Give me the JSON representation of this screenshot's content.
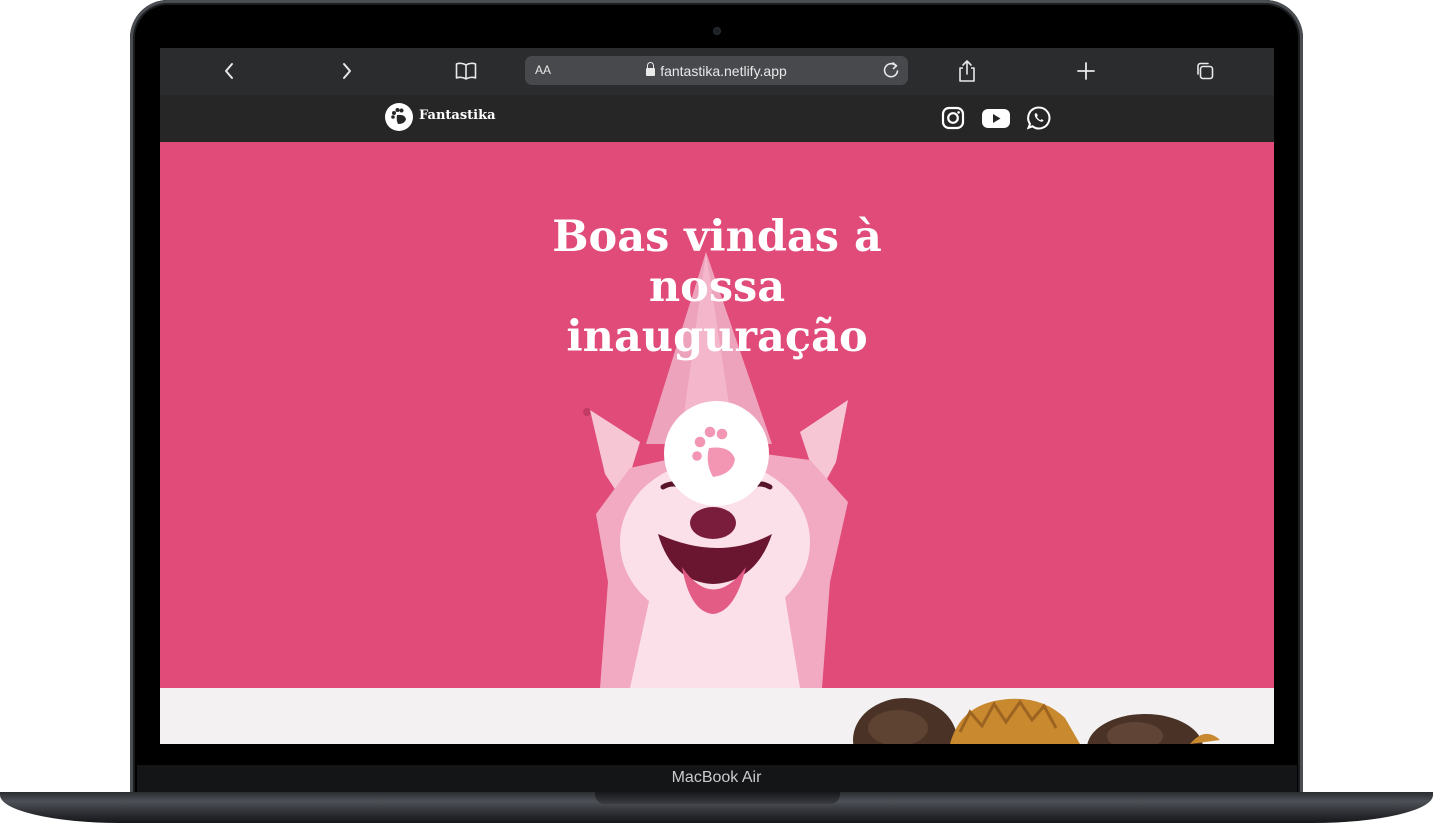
{
  "device": {
    "label": "MacBook Air"
  },
  "browser": {
    "text_size_label": "AA",
    "url": "fantastika.netlify.app",
    "icons": [
      "chevron-left-icon",
      "chevron-right-icon",
      "book-icon",
      "lock-icon",
      "reload-icon",
      "share-icon",
      "plus-icon",
      "tabs-icon"
    ]
  },
  "site": {
    "brand": "Fantastika",
    "social_icons": [
      "instagram-icon",
      "youtube-icon",
      "whatsapp-icon"
    ],
    "hero": {
      "headline": "Boas vindas à nossa inauguração",
      "background_color": "#e04b79"
    }
  },
  "colors": {
    "nav_bg": "#262627",
    "safari_bg": "#2b2c2e",
    "accent": "#e04b79"
  }
}
